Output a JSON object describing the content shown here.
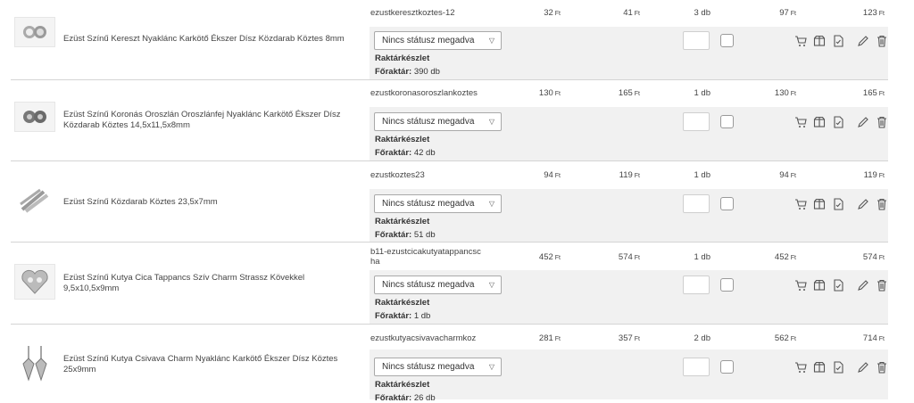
{
  "currency": "Ft",
  "status_placeholder": "Nincs státusz megadva",
  "stock_label": "Raktárkészlet",
  "main_stock_prefix": "Főraktár:",
  "rows": [
    {
      "name": "Ezüst Színű Kereszt Nyaklánc Karkötő Ékszer Dísz Közdarab Köztes 8mm",
      "code": "ezustkeresztkoztes-12",
      "price_net": "32",
      "price_gross": "41",
      "qty": "3 db",
      "total_net": "97",
      "total_gross": "123",
      "stock": "390 db"
    },
    {
      "name": "Ezüst Színű Koronás Oroszlán Oroszlánfej Nyaklánc Karkötő Ékszer Dísz Közdarab Köztes 14,5x11,5x8mm",
      "code": "ezustkoronasoroszlankoztes",
      "price_net": "130",
      "price_gross": "165",
      "qty": "1 db",
      "total_net": "130",
      "total_gross": "165",
      "stock": "42 db"
    },
    {
      "name": "Ezüst Színű Közdarab Köztes 23,5x7mm",
      "code": "ezustkoztes23",
      "price_net": "94",
      "price_gross": "119",
      "qty": "1 db",
      "total_net": "94",
      "total_gross": "119",
      "stock": "51 db"
    },
    {
      "name": "Ezüst Színű Kutya Cica Tappancs Szív Charm Strassz Kövekkel 9,5x10,5x9mm",
      "code": "b11-ezustcicakutyatappancscha",
      "price_net": "452",
      "price_gross": "574",
      "qty": "1 db",
      "total_net": "452",
      "total_gross": "574",
      "stock": "1 db"
    },
    {
      "name": "Ezüst Színű Kutya Csivava Charm Nyaklánc Karkötő Ékszer Dísz Köztes 25x9mm",
      "code": "ezustkutyacsivavacharmkoz",
      "price_net": "281",
      "price_gross": "357",
      "qty": "2 db",
      "total_net": "562",
      "total_gross": "714",
      "stock": "26 db"
    }
  ],
  "icons": [
    "cart-icon",
    "box-icon",
    "document-icon",
    "pencil-icon",
    "trash-icon"
  ]
}
